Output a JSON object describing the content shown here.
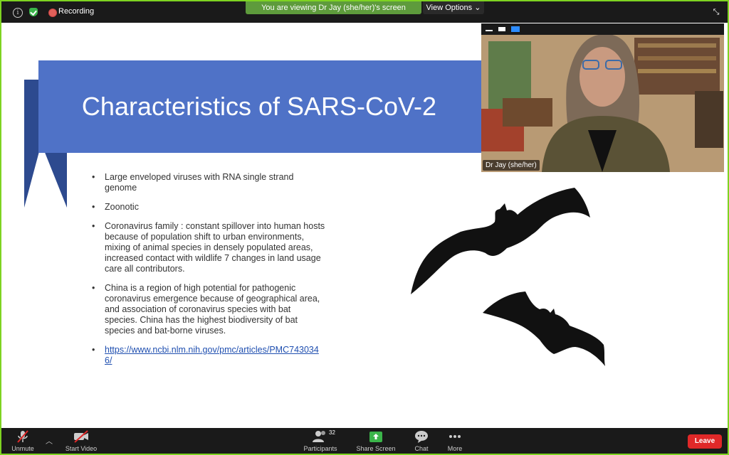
{
  "topbar": {
    "recording_label": "Recording",
    "viewing_banner": "You are viewing Dr Jay (she/her)'s screen",
    "view_options_label": "View Options"
  },
  "slide": {
    "title": "Characteristics of SARS-CoV-2",
    "bullets": [
      "Large enveloped viruses with RNA single strand genome",
      "Zoonotic",
      "Coronavirus family : constant spillover into human hosts  because of population shift to urban environments, mixing of animal species in densely populated areas, increased contact with wildlife 7 changes in land usage care all contributors.",
      "China is a region of high potential for pathogenic coronavirus emergence because of geographical area, and association of coronavirus species with bat species. China has the highest biodiversity of bat species and bat-borne viruses."
    ],
    "link": "https://www.ncbi.nlm.nih.gov/pmc/articles/PMC7430346/"
  },
  "participant": {
    "name": "Dr Jay (she/her)"
  },
  "toolbar": {
    "unmute_label": "Unmute",
    "start_video_label": "Start Video",
    "participants_label": "Participants",
    "participants_count": "32",
    "share_screen_label": "Share Screen",
    "chat_label": "Chat",
    "more_label": "More",
    "leave_label": "Leave"
  },
  "colors": {
    "frame_border": "#7ed321",
    "title_banner": "#4f72c7",
    "leave": "#e02828",
    "share_screen": "#3bb54a"
  }
}
